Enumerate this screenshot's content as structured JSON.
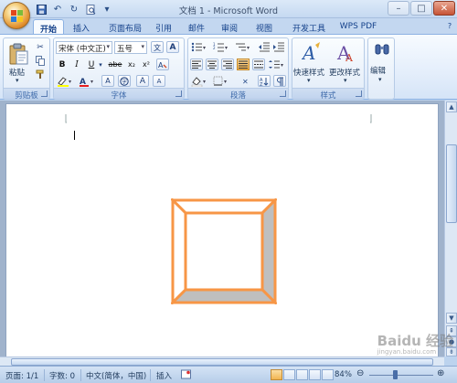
{
  "window": {
    "title": "文档 1 - Microsoft Word"
  },
  "quick_access": [
    {
      "name": "save-icon",
      "glyph": "💾"
    },
    {
      "name": "undo-icon",
      "glyph": "↶"
    },
    {
      "name": "redo-icon",
      "glyph": "↻"
    },
    {
      "name": "print-preview-icon",
      "glyph": "🗋"
    },
    {
      "name": "customize-qat-icon",
      "glyph": "▾"
    }
  ],
  "tabs": [
    "开始",
    "插入",
    "页面布局",
    "引用",
    "邮件",
    "审阅",
    "视图",
    "开发工具",
    "WPS PDF"
  ],
  "ribbon": {
    "clipboard": {
      "paste_label": "粘贴",
      "group_label": "剪贴板"
    },
    "font": {
      "font_name": "宋体 (中文正)",
      "font_size": "五号",
      "group_label": "字体",
      "bold": "B",
      "italic": "I",
      "underline": "U",
      "strike": "abe",
      "subscript": "x₂",
      "superscript": "x²",
      "grow": "A",
      "shrink": "A"
    },
    "paragraph": {
      "group_label": "段落"
    },
    "styles": {
      "quick_styles_label": "快速样式",
      "change_styles_label": "更改样式",
      "group_label": "样式"
    },
    "editing": {
      "label": "编辑"
    }
  },
  "document": {
    "shape": {
      "type": "bevel",
      "outline_color": "#f79646",
      "shade_color": "#bfbfbf"
    }
  },
  "statusbar": {
    "page": "页面: 1/1",
    "words": "字数: 0",
    "language": "中文(简体，中国)",
    "mode": "插入",
    "zoom": "84%",
    "zoom_level": 0.84
  },
  "watermark": "Baidu 经验",
  "watermark_sub": "jingyan.baidu.com",
  "colors": {
    "accent": "#f79646",
    "ribbon_blue": "#c3d7f0"
  }
}
